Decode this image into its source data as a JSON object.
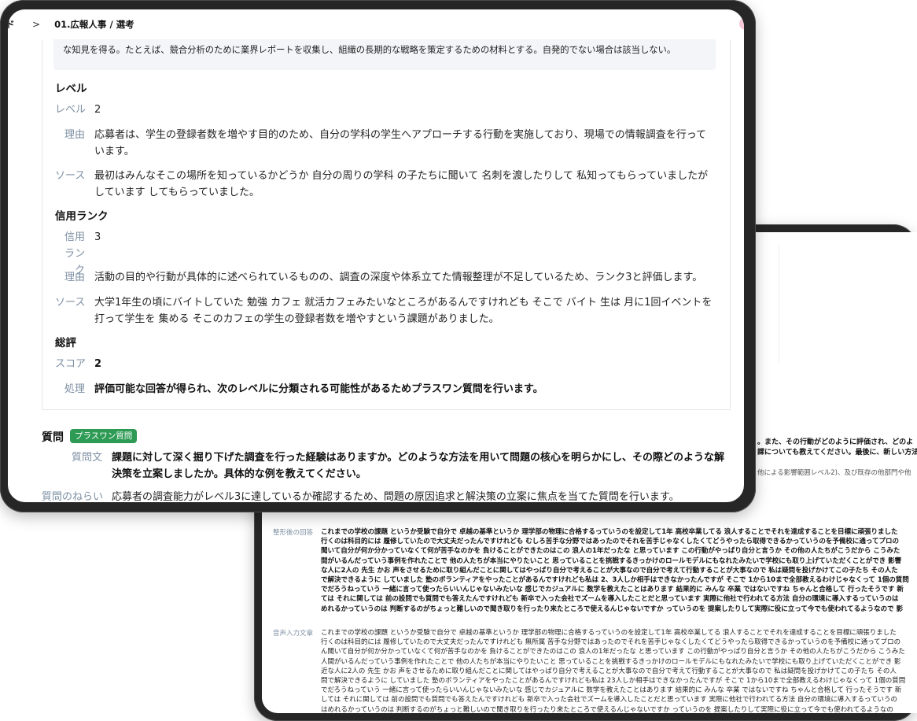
{
  "back_window": {
    "top_right_lines": [
      "。また、その行動がどのように評価され、どのよ",
      "課についても教えてください。最後に、新しい方法",
      "他による影響範囲レベル2)、及び既存の他部門や他"
    ],
    "formatted_answer": {
      "label": "整形後の回答",
      "lines": [
        "これまでの学校の課題 というか受験で自分で 卓越の基準というか 理学部の物理に合格するっていうのを設定して1年 高校卒業してる 浪人することでそれを達成することを目標に頑張りました",
        "行くのは科目的には 履修していたので大丈夫だったんですけれども むしろ苦手な分野ではあったのでそれを苦手じゃなくしたくてどうやったら取得できるかっていうのを予備校に通ってプロの",
        "聞いて自分が何か分かっていなくて何が苦手なのかを 負けることができたのはこの 浪人の1年だったな と思っています この行動がやっぱり自分と言うか その他の人たちがこうだから こうみた",
        "間がいるんだっていう事例を作れたことで 他の人たちが本当にやりたいこと 思っていることを挑戦するきっかけのロールモデルにもなれたみたいで学校にも取り上げていただくことができ 影響",
        "な人に2人の 先生 かお 声をさせるために取り組んだことに関してはやっぱり自分で考えることが大事なので自分で考えて行動することが大事なので 私は疑問を投げかけてこの子たち その人た",
        "で解決できるように していました 塾のボランティアをやったことがあるんですけれども私は 2、3人しか相手はできなかったんですが そこで 1から10まで全部教えるわけじゃなくって 1個の質問",
        "でだろうねっていう 一緒に言って使ったらいいんじゃないみたいな 感じでカジュアルに 数学を教えたことはあります 結果的に みんな 卒業 ではないですね ちゃんと合格して 行ったそうです 新",
        "ては それに関しては 前の設問でも質問でも答えたんですけれども 新卒で入った会社でズームを導入したことだと思っています 実際に他社で行われてる方法 自分の環境に導入するっていうのは",
        "めれるかっていうのは 判断するのがちょっと難しいので聞き取りを行ったり来たところで使えるんじゃないですか っていうのを 提案したりして実際に役に立って今でも使われてるようなので 影"
      ]
    },
    "voice_input": {
      "label": "音声入力文章",
      "lines": [
        "これまでの学校の課題 というか受験で自分で 卓越の基準というか 理学部の物理に合格するっていうのを設定して1年 高校卒業してる 浪人することでそれを達成することを目標に頑張りました",
        "行くのは科目的には 履修していたので大丈夫だったんですけれども 無所属 苦手な分野ではあったのでそれを苦手じゃなくしたくてどうやったら取得できるかっていうのを予備校に通ってプロの",
        "ん聞いて自分が何か分かっていなくて何が苦手なのかを 負けることができたのはこの 浪人の1年だったな と思っています この行動がやっぱり自分と言うか その他の人たちがこうだから こうみた",
        "人間がいるんだっていう事例を作れたことで 他の人たちが本当にやりたいこと 思っていることを挑戦するきっかけのロールモデルにもなれたみたいで学校にも取り上げていただくことができ 影",
        "近な人に2人の 先生 かお 声をさせるために取り組んだことに関してはやっぱり自分で考えることが大事なので自分で考えて行動することが大事なので 私は疑問を投げかけてこの子たち その人",
        "問で解決できるように していました 塾のボランティアをやったことがあるんですけれども私は 23人しか相手はできなかったんですが そこで 1から10まで全部教えるわけじゃなくって 1個の質問",
        "でだろうねっていう 一緒に言って使ったらいいんじゃないみたいな 感じでカジュアルに 数学を教えたことはあります 結果的に みんな 卒業 ではないですね ちゃんと合格して 行ったそうです 新",
        "しては それに関しては 前の設問でも質問でも答えたんですけれども 新卒で入った会社でズームを導入したことだと思っています 実際に他社で行われてる方法 自分の環境に導入するっていうの",
        "はめれるかっていうのは 判断するのがちょっと難しいので聞き取りを行ったり来たところで使えるんじゃないですか っていうのを 提案したりして実際に役に立って今でも使われてるようなの"
      ]
    }
  },
  "front_window": {
    "breadcrumb": {
      "prev": "ド",
      "separator": ">",
      "current": "01.広報人事 / 選考"
    },
    "callout_text": "な知見を得る。たとえば、競合分析のために業界レポートを収集し、組織の長期的な戦略を策定するための材料とする。自発的でない場合は該当しない。",
    "level": {
      "heading": "レベル",
      "value_label": "レベル",
      "value": "2",
      "reason_label": "理由",
      "reason": "応募者は、学生の登録者数を増やす目的のため、自分の学科の学生へアプローチする行動を実施しており、現場での情報調査を行っています。",
      "source_label": "ソース",
      "source": "最初はみんなそこの場所を知っているかどうか 自分の周りの学科 の子たちに聞いて 名刺を渡したりして 私知ってもらっていましたが しています してもらっていました。"
    },
    "credit_rank": {
      "heading": "信用ランク",
      "value_label": "信用ランク",
      "value": "3",
      "reason_label": "理由",
      "reason": "活動の目的や行動が具体的に述べられているものの、調査の深度や体系立てた情報整理が不足しているため、ランク3と評価します。",
      "source_label": "ソース",
      "source": "大学1年生の頃にバイトしていた 勉強 カフェ 就活カフェみたいなところがあるんですけれども そこで バイト 生は 月に1回イベントを打って学生を 集める そこのカフェの学生の登録者数を増やすという課題がありました。"
    },
    "overall": {
      "heading": "総評",
      "score_label": "スコア",
      "score": "2",
      "action_label": "処理",
      "action": "評価可能な回答が得られ、次のレベルに分類される可能性があるためプラスワン質問を行います。"
    },
    "question": {
      "heading": "質問",
      "badge": "プラスワン質問",
      "text_label": "質問文",
      "text": "課題に対して深く掘り下げた調査を行った経験はありますか。どのような方法を用いて問題の核心を明らかにし、その際どのような解決策を立案しましたか。具体的な例を教えてください。",
      "aim_label": "質問のねらい",
      "aim": "応募者の調査能力がレベル3に達しているか確認するため、問題の原因追求と解決策の立案に焦点を当てた質問を行います。"
    }
  }
}
